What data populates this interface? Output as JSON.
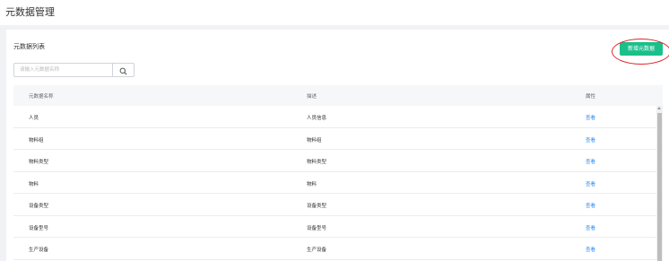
{
  "header": {
    "title": "元数据管理"
  },
  "card": {
    "title": "元数据列表",
    "add_button": "新增元数据",
    "search": {
      "placeholder": "请输入元数据名称",
      "value": ""
    }
  },
  "table": {
    "columns": [
      "元数据名称",
      "描述",
      "属性"
    ],
    "rows": [
      {
        "name": "人员",
        "desc": "人员信息",
        "action": "查看"
      },
      {
        "name": "物料组",
        "desc": "物料组",
        "action": "查看"
      },
      {
        "name": "物料类型",
        "desc": "物料类型",
        "action": "查看"
      },
      {
        "name": "物料",
        "desc": "物料",
        "action": "查看"
      },
      {
        "name": "设备类型",
        "desc": "设备类型",
        "action": "查看"
      },
      {
        "name": "设备型号",
        "desc": "设备型号",
        "action": "查看"
      },
      {
        "name": "生产设备",
        "desc": "生产设备",
        "action": "查看"
      }
    ]
  },
  "colors": {
    "accent": "#1bbf8a",
    "link": "#2d8cf0",
    "highlight": "#e0262b"
  },
  "icons": {
    "search": "search-icon"
  }
}
